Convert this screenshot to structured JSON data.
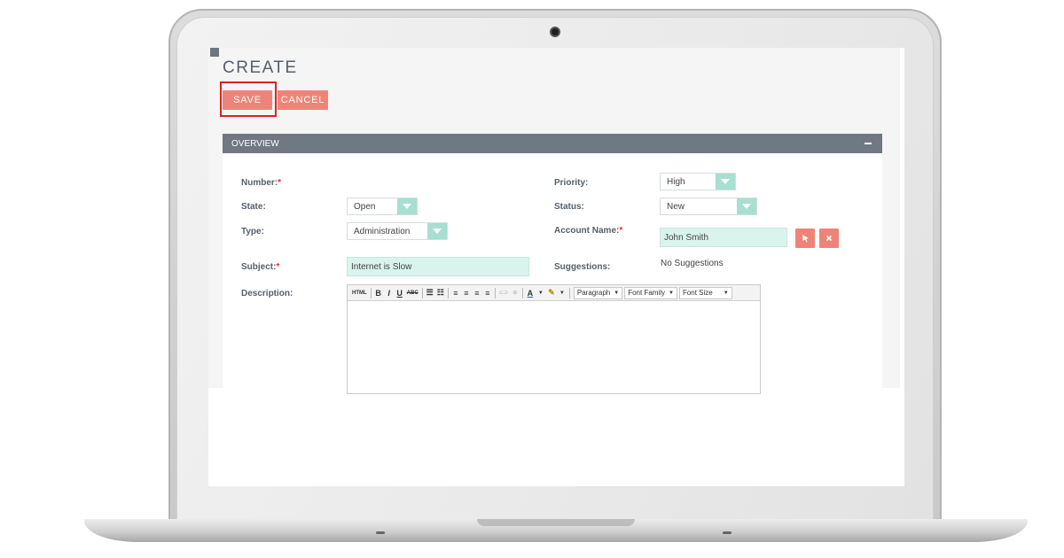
{
  "page": {
    "title": "CREATE",
    "save_label": "SAVE",
    "cancel_label": "CANCEL"
  },
  "panel": {
    "title": "OVERVIEW",
    "collapse": "–"
  },
  "fields": {
    "number": {
      "label": "Number:",
      "required": "*"
    },
    "state": {
      "label": "State:",
      "value": "Open"
    },
    "type": {
      "label": "Type:",
      "value": "Administration"
    },
    "subject": {
      "label": "Subject:",
      "required": "*",
      "value": "Internet is Slow"
    },
    "description": {
      "label": "Description:"
    },
    "priority": {
      "label": "Priority:",
      "value": "High"
    },
    "status": {
      "label": "Status:",
      "value": "New"
    },
    "account_name": {
      "label": "Account Name:",
      "required": "*",
      "value": "John Smith"
    },
    "suggestions": {
      "label": "Suggestions:",
      "value": "No Suggestions"
    }
  },
  "editor": {
    "toolbar": {
      "html": "HTML",
      "bold": "B",
      "italic": "I",
      "underline": "U",
      "strike": "ABC",
      "unordered": "☰",
      "ordered": "☷",
      "align_left": "≡",
      "align_center": "≡",
      "align_right": "≡",
      "align_justify": "≡",
      "link": "⊂⊃",
      "unlink": "⊘",
      "text_color": "A",
      "highlight": "✎",
      "paragraph": "Paragraph",
      "font_family": "Font Family",
      "font_size": "Font Size"
    }
  },
  "icons": {
    "select_account": "cursor-arrow-icon",
    "clear_account": "close-icon",
    "dropdown": "chevron-down-icon"
  },
  "colors": {
    "accent": "#f08377",
    "header": "#6f7883",
    "input_bg": "#d8f4ed",
    "dropdown_arrow": "#a7dfd1",
    "highlight_border": "#e02020"
  }
}
